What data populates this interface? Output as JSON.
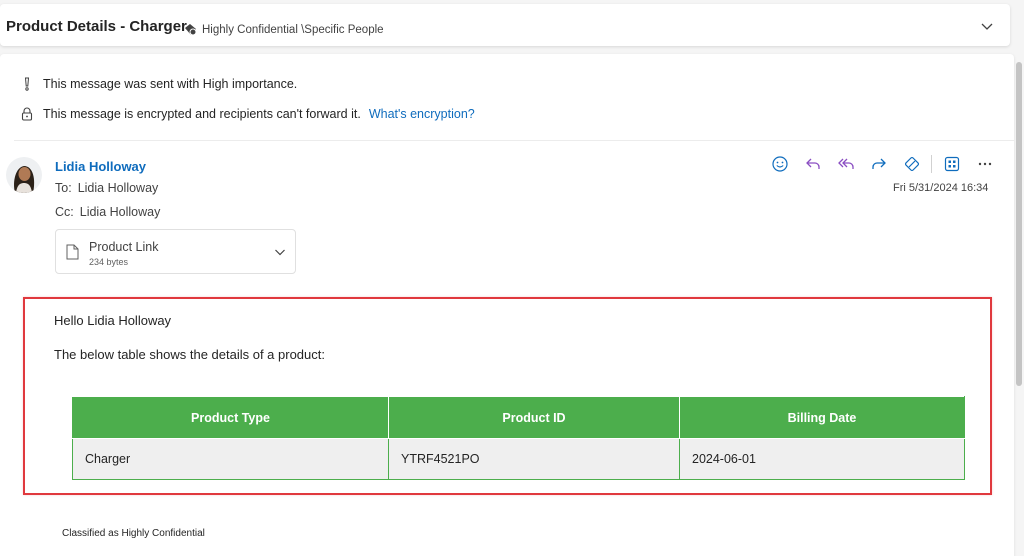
{
  "header": {
    "subject": "Product Details - Charger",
    "sensitivity_label": "Highly Confidential \\Specific People"
  },
  "notices": {
    "importance": "This message was sent with High importance.",
    "encryption": "This message is encrypted and recipients can't forward it.",
    "encryption_link": "What's encryption?"
  },
  "message": {
    "sender": "Lidia Holloway",
    "to_label": "To:",
    "to": "Lidia Holloway",
    "cc_label": "Cc:",
    "cc": "Lidia Holloway",
    "date": "Fri 5/31/2024 16:34",
    "actions": [
      "emoji-icon",
      "reply-icon",
      "reply-all-icon",
      "forward-icon",
      "sensitivity-icon",
      "apps-icon",
      "more-icon"
    ]
  },
  "attachment": {
    "name": "Product Link",
    "size": "234 bytes"
  },
  "body": {
    "greeting": "Hello Lidia Holloway",
    "intro": "The below table shows the details of a product:",
    "table": {
      "headers": [
        "Product Type",
        "Product ID",
        "Billing Date"
      ],
      "rows": [
        [
          "Charger",
          "YTRF4521PO",
          "2024-06-01"
        ]
      ]
    },
    "classification": "Classified as Highly Confidential"
  },
  "colors": {
    "accent": "#0f6cbd",
    "table_header": "#4cae4c",
    "highlight_border": "#e0393e"
  }
}
